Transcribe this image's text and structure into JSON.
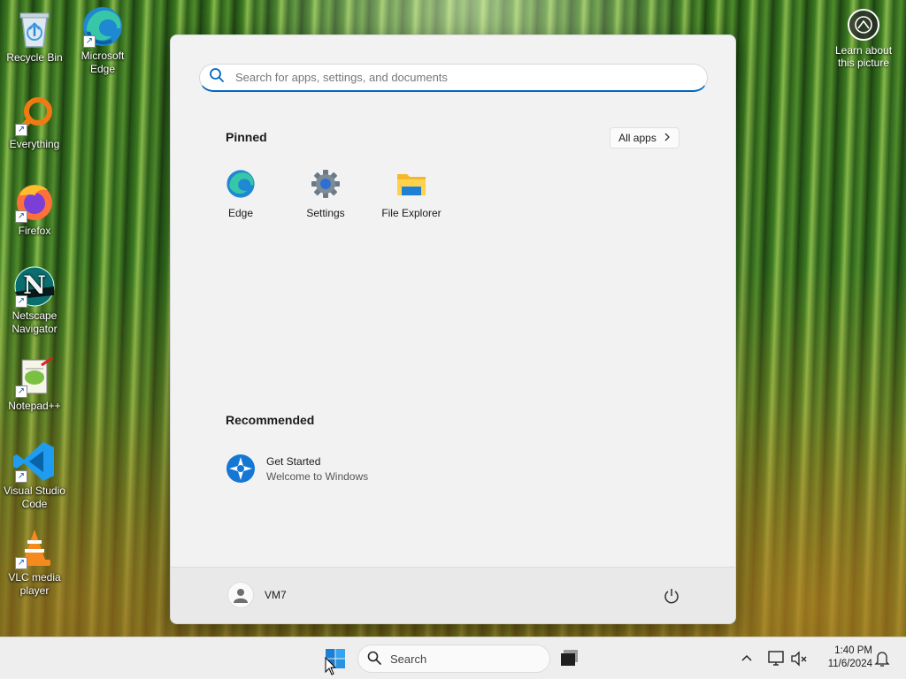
{
  "desktop": {
    "icons": [
      {
        "label": "Recycle Bin",
        "icon": "recycle-bin-icon"
      },
      {
        "label": "Microsoft Edge",
        "icon": "edge-icon"
      },
      {
        "label": "Everything",
        "icon": "everything-search-icon"
      },
      {
        "label": "Firefox",
        "icon": "firefox-icon"
      },
      {
        "label": "Netscape Navigator",
        "icon": "netscape-icon"
      },
      {
        "label": "Notepad++",
        "icon": "notepadpp-icon"
      },
      {
        "label": "Visual Studio Code",
        "icon": "vscode-icon"
      },
      {
        "label": "VLC media player",
        "icon": "vlc-icon"
      }
    ],
    "learn_about_picture": "Learn about this picture"
  },
  "start_menu": {
    "search_placeholder": "Search for apps, settings, and documents",
    "pinned_title": "Pinned",
    "all_apps_label": "All apps",
    "pinned": [
      {
        "label": "Edge",
        "icon": "edge-icon"
      },
      {
        "label": "Settings",
        "icon": "settings-gear-icon"
      },
      {
        "label": "File Explorer",
        "icon": "folder-icon"
      }
    ],
    "recommended_title": "Recommended",
    "recommended": [
      {
        "title": "Get Started",
        "subtitle": "Welcome to Windows",
        "icon": "get-started-icon"
      }
    ],
    "user_name": "VM7"
  },
  "taskbar": {
    "search_label": "Search",
    "time": "1:40 PM",
    "date": "11/6/2024"
  },
  "colors": {
    "accent": "#0067c0",
    "start_bg": "#f2f2f2",
    "taskbar_bg": "#eeeeee"
  }
}
